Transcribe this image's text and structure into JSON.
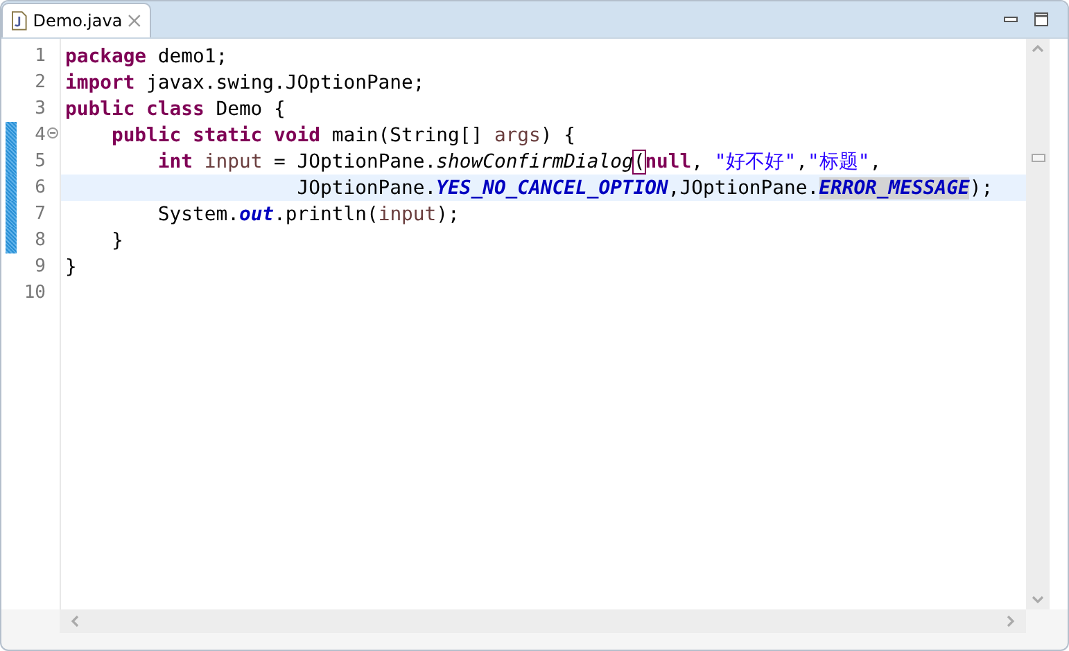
{
  "tab": {
    "title": "Demo.java",
    "selected": true
  },
  "lines": [
    {
      "number": "1",
      "current": false,
      "changed": false,
      "tokens": [
        {
          "text": "package",
          "kind": "keyword"
        },
        {
          "text": " demo1;",
          "kind": "plain"
        }
      ]
    },
    {
      "number": "2",
      "current": false,
      "changed": false,
      "tokens": [
        {
          "text": "import",
          "kind": "keyword"
        },
        {
          "text": " javax.swing.JOptionPane;",
          "kind": "plain"
        }
      ]
    },
    {
      "number": "3",
      "current": false,
      "changed": false,
      "tokens": [
        {
          "text": "public class",
          "kind": "keyword"
        },
        {
          "text": " Demo {",
          "kind": "plain"
        }
      ]
    },
    {
      "number": "4",
      "current": false,
      "changed": true,
      "fold": {
        "expanded": true
      },
      "tokens": [
        {
          "text": "    public static void",
          "kind": "keyword"
        },
        {
          "text": " main(String[] ",
          "kind": "plain"
        },
        {
          "text": "args",
          "kind": "local"
        },
        {
          "text": ") {",
          "kind": "plain"
        }
      ]
    },
    {
      "number": "5",
      "current": false,
      "changed": true,
      "tokens": [
        {
          "text": "        int",
          "kind": "keyword"
        },
        {
          "text": " input",
          "kind": "local"
        },
        {
          "text": " = JOptionPane.",
          "kind": "plain"
        },
        {
          "text": "showConfirmDialog",
          "kind": "method"
        },
        {
          "text": "(",
          "kind": "bracket"
        },
        {
          "text": "null",
          "kind": "keyword"
        },
        {
          "text": ", ",
          "kind": "plain"
        },
        {
          "text": "\"好不好\"",
          "kind": "string"
        },
        {
          "text": ",",
          "kind": "plain"
        },
        {
          "text": "\"标题\"",
          "kind": "string"
        },
        {
          "text": ",",
          "kind": "plain"
        }
      ]
    },
    {
      "number": "6",
      "current": true,
      "changed": true,
      "tokens": [
        {
          "text": "                    JOptionPane.",
          "kind": "plain"
        },
        {
          "text": "YES_NO_CANCEL_OPTION",
          "kind": "field"
        },
        {
          "text": ",JOptionPane.",
          "kind": "plain"
        },
        {
          "text": "ERROR_MESSAGE",
          "kind": "occurrence"
        },
        {
          "text": ");",
          "kind": "plain"
        }
      ]
    },
    {
      "number": "7",
      "current": false,
      "changed": true,
      "tokens": [
        {
          "text": "        System.",
          "kind": "plain"
        },
        {
          "text": "out",
          "kind": "field"
        },
        {
          "text": ".println(",
          "kind": "plain"
        },
        {
          "text": "input",
          "kind": "local"
        },
        {
          "text": ");",
          "kind": "plain"
        }
      ]
    },
    {
      "number": "8",
      "current": false,
      "changed": true,
      "tokens": [
        {
          "text": "    }",
          "kind": "plain"
        }
      ]
    },
    {
      "number": "9",
      "current": false,
      "changed": false,
      "tokens": [
        {
          "text": "}",
          "kind": "plain"
        }
      ]
    },
    {
      "number": "10",
      "current": false,
      "changed": false
    }
  ]
}
